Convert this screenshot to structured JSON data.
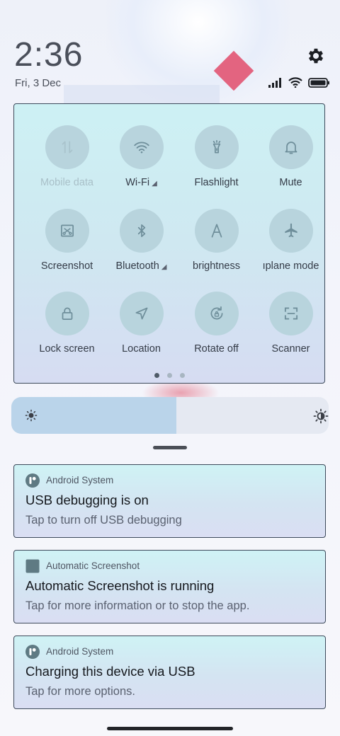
{
  "status": {
    "time": "2:36",
    "date": "Fri, 3 Dec",
    "icons": [
      "signal-icon",
      "wifi-icon",
      "battery-icon"
    ]
  },
  "quick_settings": {
    "tiles": [
      {
        "label": "Mobile data",
        "icon": "mobile-data-icon",
        "enabled": false
      },
      {
        "label": "Wi-Fi",
        "icon": "wifi-icon",
        "has_more": true
      },
      {
        "label": "Flashlight",
        "icon": "flashlight-icon"
      },
      {
        "label": "Mute",
        "icon": "bell-icon"
      },
      {
        "label": "Screenshot",
        "icon": "screenshot-icon"
      },
      {
        "label": "Bluetooth",
        "icon": "bluetooth-icon",
        "has_more": true
      },
      {
        "label": "brightness",
        "icon": "auto-brightness-icon"
      },
      {
        "label": "ıplane mode",
        "icon": "airplane-icon"
      },
      {
        "label": "Lock screen",
        "icon": "lock-icon"
      },
      {
        "label": "Location",
        "icon": "location-icon"
      },
      {
        "label": "Rotate off",
        "icon": "rotate-lock-icon"
      },
      {
        "label": "Scanner",
        "icon": "scanner-icon"
      }
    ],
    "pages": 3,
    "current_page": 1
  },
  "brightness": {
    "level": 0.52
  },
  "notifications": [
    {
      "app": "Android System",
      "icon": "android-system-icon",
      "title": "USB debugging is on",
      "body": "Tap to turn off USB debugging"
    },
    {
      "app": "Automatic Screenshot",
      "icon": "automatic-screenshot-icon",
      "title": "Automatic Screenshot is running",
      "body": "Tap for more information or to stop the app."
    },
    {
      "app": "Android System",
      "icon": "android-system-icon",
      "title": "Charging this device via USB",
      "body": "Tap for more options."
    }
  ],
  "colors": {
    "tile_circle": "#b8d4dd",
    "icon_stroke": "#6f8f9b",
    "panel_border": "#3d4a5b",
    "brightness_fill": "#bad4ea"
  }
}
